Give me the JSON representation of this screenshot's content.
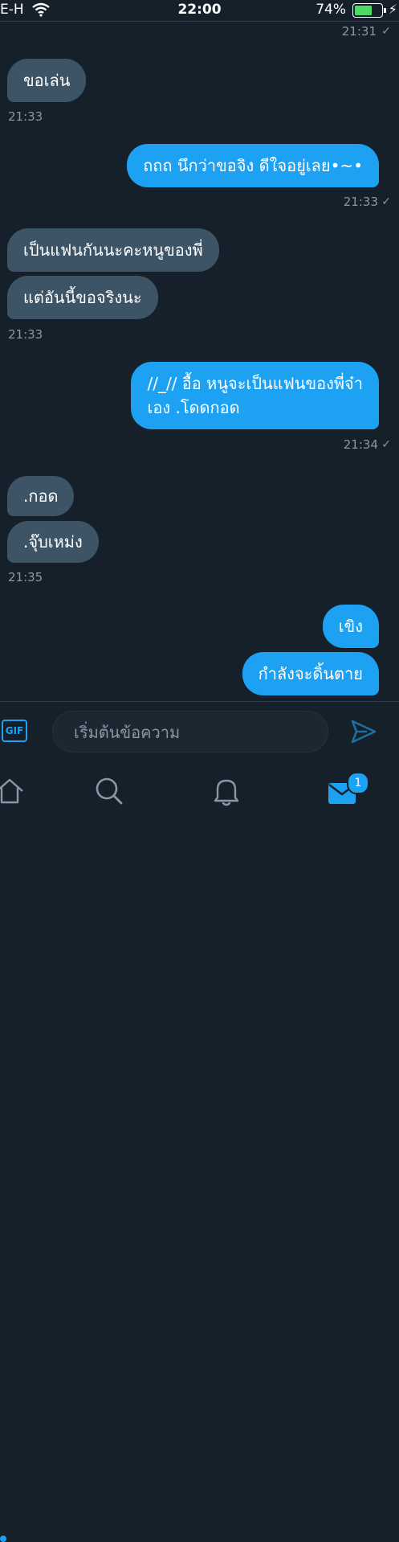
{
  "status_bar": {
    "carrier": "E-H",
    "time": "22:00",
    "battery_percent": "74%",
    "battery_level": 0.74
  },
  "colors": {
    "background": "#15202b",
    "incoming_bubble": "#3d5466",
    "outgoing_bubble": "#1da1f2",
    "accent": "#1da1f2",
    "timestamp": "#8899a6"
  },
  "chat": {
    "top_timestamp": "21:31",
    "messages": [
      {
        "side": "in",
        "text": "ขอเล่น"
      },
      {
        "side": "ts_in",
        "text": "21:33"
      },
      {
        "side": "out",
        "text": "ถถถ นึกว่าขอจิง ดีใจอยู่เลย•~•"
      },
      {
        "side": "ts_out",
        "text": "21:33"
      },
      {
        "side": "in",
        "text": "เป็นแฟนกันนะคะหนูของพี่"
      },
      {
        "side": "in",
        "text": "แต่อันนี้ขอจริงนะ"
      },
      {
        "side": "ts_in",
        "text": "21:33"
      },
      {
        "side": "out",
        "line1": "//_// อื้อ หนูจะเป็นแฟนของพี่จ๋า",
        "line2": "เอง .โดดกอด"
      },
      {
        "side": "ts_out",
        "text": "21:34"
      },
      {
        "side": "in",
        "text": ".กอด"
      },
      {
        "side": "in",
        "text": ".จุ๊บเหม่ง"
      },
      {
        "side": "ts_in",
        "text": "21:35"
      },
      {
        "side": "out",
        "text": "เขิง"
      },
      {
        "side": "out",
        "text": "กำลังจะดิ้นตาย"
      }
    ]
  },
  "composer": {
    "gif_label": "GIF",
    "placeholder": "เริ่มต้นข้อความ",
    "value": "",
    "send_icon": "send-icon"
  },
  "tab_bar": {
    "tabs": [
      "home-icon",
      "search-icon",
      "bell-icon",
      "mail-icon"
    ],
    "messages_badge": "1"
  }
}
